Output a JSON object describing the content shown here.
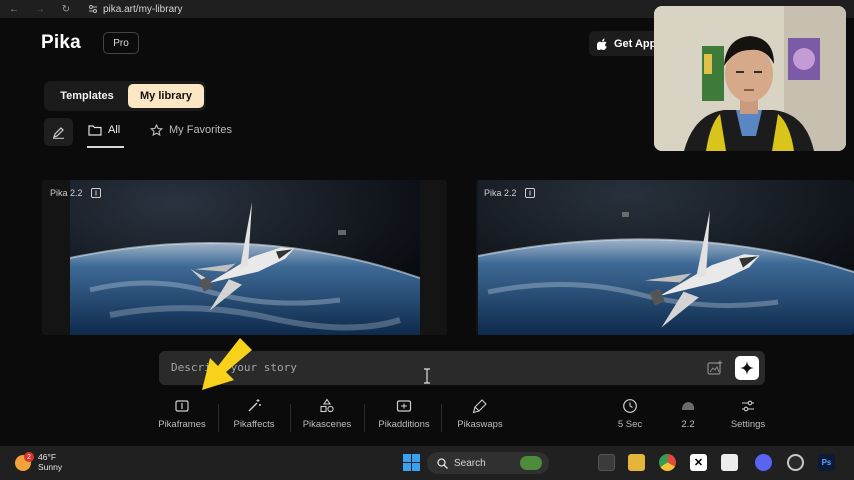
{
  "browser": {
    "url": "pika.art/my-library"
  },
  "header": {
    "logo": "Pika",
    "plan_badge": "Pro",
    "get_app_label": "Get App"
  },
  "tabs": [
    {
      "label": "Templates"
    },
    {
      "label": "My library"
    }
  ],
  "filters": {
    "all": "All",
    "favorites": "My Favorites"
  },
  "cards": [
    {
      "model": "Pika 2.2"
    },
    {
      "model": "Pika 2.2"
    }
  ],
  "prompt": {
    "placeholder": "Describe your story"
  },
  "tools": [
    {
      "label": "Pikaframes",
      "icon": "pikaframes-icon"
    },
    {
      "label": "Pikaffects",
      "icon": "magic-wand-icon"
    },
    {
      "label": "Pikascenes",
      "icon": "shapes-icon"
    },
    {
      "label": "Pikadditions",
      "icon": "add-frame-icon"
    },
    {
      "label": "Pikaswaps",
      "icon": "brush-icon"
    },
    {
      "label": "5 Sec",
      "icon": "clock-icon"
    },
    {
      "label": "2.2",
      "icon": "cloud-icon"
    },
    {
      "label": "Settings",
      "icon": "sliders-icon"
    }
  ],
  "taskbar": {
    "weather_temp": "46°F",
    "weather_desc": "Sunny",
    "weather_badge": "2",
    "search_label": "Search"
  },
  "colors": {
    "accent": "#fbe7c3",
    "arrow": "#f7d11a"
  }
}
